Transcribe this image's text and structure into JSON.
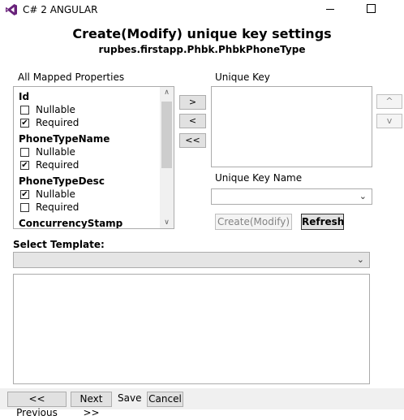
{
  "window": {
    "title": "C# 2 ANGULAR"
  },
  "header": {
    "title": "Create(Modify) unique key settings",
    "subtitle": "rupbes.firstapp.Phbk.PhbkPhoneType"
  },
  "mapped": {
    "label": "All Mapped Properties",
    "properties": [
      {
        "name": "Id",
        "nullable_label": "Nullable",
        "nullable": false,
        "required_label": "Required",
        "required": true
      },
      {
        "name": "PhoneTypeName",
        "nullable_label": "Nullable",
        "nullable": false,
        "required_label": "Required",
        "required": true
      },
      {
        "name": "PhoneTypeDesc",
        "nullable_label": "Nullable",
        "nullable": true,
        "required_label": "Required",
        "required": false
      },
      {
        "name": "ConcurrencyStamp"
      }
    ]
  },
  "move_buttons": {
    "add": ">",
    "remove": "<",
    "remove_all": "<<"
  },
  "unique_key": {
    "label": "Unique Key",
    "up": "^",
    "down": "v"
  },
  "unique_key_name": {
    "label": "Unique Key Name",
    "value": ""
  },
  "actions": {
    "create": "Create(Modify)",
    "refresh": "Refresh"
  },
  "template": {
    "label": "Select Template:",
    "value": ""
  },
  "footer": {
    "previous": "<< Previous",
    "next": "Next >>",
    "save": "Save",
    "cancel": "Cancel"
  },
  "icons": {
    "app": "visual-studio-icon",
    "minimize": "minimize-icon",
    "maximize": "maximize-icon",
    "check": "check-icon"
  },
  "colors": {
    "app_icon": "#68217a",
    "bottombar": "#f0f0f0"
  }
}
